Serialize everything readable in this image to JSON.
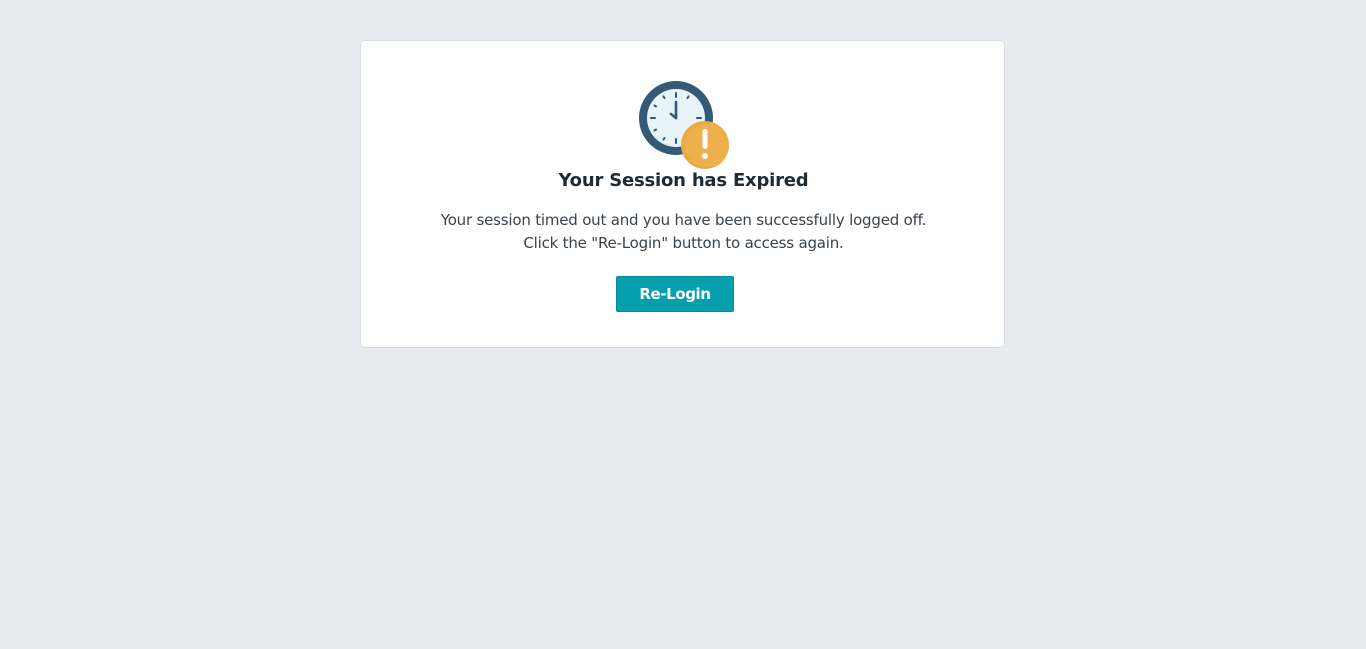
{
  "dialog": {
    "icon": "clock-warning-icon",
    "title": "Your Session has Expired",
    "message_line1": "Your session timed out and you have been successfully logged off.",
    "message_line2": "Click the \"Re-Login\" button to access again.",
    "button_label": "Re-Login"
  },
  "colors": {
    "background": "#e7eaee",
    "card": "#ffffff",
    "button": "#06a0ad",
    "clock_ring": "#355a76",
    "clock_face": "#e8f3f7",
    "warning": "#e8aa45"
  }
}
